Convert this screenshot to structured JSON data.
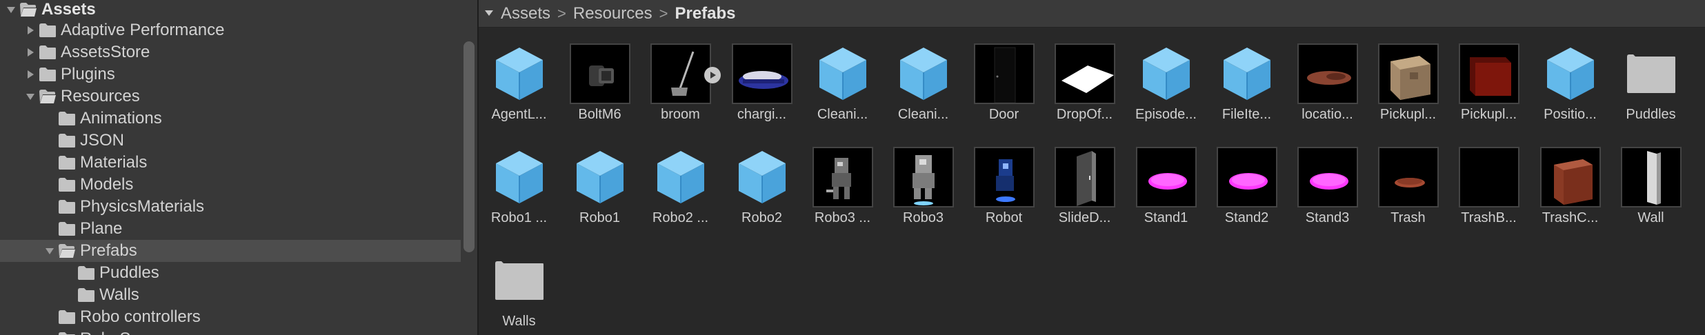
{
  "tree": {
    "items": [
      {
        "label": "Assets",
        "state": "open",
        "bold": true
      },
      {
        "label": "Adaptive Performance",
        "state": "closed"
      },
      {
        "label": "AssetsStore",
        "state": "closed"
      },
      {
        "label": "Plugins",
        "state": "closed"
      },
      {
        "label": "Resources",
        "state": "open"
      },
      {
        "label": "Animations",
        "state": "leaf"
      },
      {
        "label": "JSON",
        "state": "leaf"
      },
      {
        "label": "Materials",
        "state": "leaf"
      },
      {
        "label": "Models",
        "state": "leaf"
      },
      {
        "label": "PhysicsMaterials",
        "state": "leaf"
      },
      {
        "label": "Plane",
        "state": "leaf"
      },
      {
        "label": "Prefabs",
        "state": "open",
        "selected": true
      },
      {
        "label": "Puddles",
        "state": "leaf"
      },
      {
        "label": "Walls",
        "state": "leaf"
      },
      {
        "label": "Robo controllers",
        "state": "leaf"
      },
      {
        "label": "RoboSc",
        "state": "leaf"
      }
    ]
  },
  "breadcrumb": {
    "items": [
      "Assets",
      "Resources",
      "Prefabs"
    ],
    "separator": ">"
  },
  "grid": {
    "items": [
      {
        "label": "AgentL...",
        "thumb": "prefab-cube"
      },
      {
        "label": "BoltM6",
        "thumb": "bolt"
      },
      {
        "label": "broom",
        "thumb": "broom",
        "play": true
      },
      {
        "label": "chargi...",
        "thumb": "charger"
      },
      {
        "label": "Cleani...",
        "thumb": "prefab-cube"
      },
      {
        "label": "Cleani...",
        "thumb": "prefab-cube"
      },
      {
        "label": "Door",
        "thumb": "door"
      },
      {
        "label": "DropOf...",
        "thumb": "plane-white"
      },
      {
        "label": "Episode...",
        "thumb": "prefab-cube"
      },
      {
        "label": "FileIte...",
        "thumb": "prefab-cube"
      },
      {
        "label": "locatio...",
        "thumb": "dish"
      },
      {
        "label": "Pickupl...",
        "thumb": "box-cardboard"
      },
      {
        "label": "Pickupl...",
        "thumb": "box-red"
      },
      {
        "label": "Positio...",
        "thumb": "prefab-cube"
      },
      {
        "label": "Puddles",
        "thumb": "folder"
      },
      {
        "label": "Robo1 ...",
        "thumb": "prefab-cube"
      },
      {
        "label": "Robo1",
        "thumb": "prefab-cube"
      },
      {
        "label": "Robo2 ...",
        "thumb": "prefab-cube"
      },
      {
        "label": "Robo2",
        "thumb": "prefab-cube"
      },
      {
        "label": "Robo3 ...",
        "thumb": "robot-gray"
      },
      {
        "label": "Robo3",
        "thumb": "robot-gray-light"
      },
      {
        "label": "Robot",
        "thumb": "robot-blue"
      },
      {
        "label": "SlideD...",
        "thumb": "slide-door"
      },
      {
        "label": "Stand1",
        "thumb": "stand-magenta"
      },
      {
        "label": "Stand2",
        "thumb": "stand-magenta"
      },
      {
        "label": "Stand3",
        "thumb": "stand-magenta"
      },
      {
        "label": "Trash",
        "thumb": "dish-small"
      },
      {
        "label": "TrashB...",
        "thumb": "empty-dark"
      },
      {
        "label": "TrashC...",
        "thumb": "box-rust"
      },
      {
        "label": "Wall",
        "thumb": "wall"
      },
      {
        "label": "Walls",
        "thumb": "folder"
      }
    ]
  },
  "colors": {
    "panel_bg": "#383838",
    "grid_bg": "#282828",
    "selection": "#4d4d4d",
    "prefab_light": "#8fd3f8",
    "prefab_mid": "#63b9ea",
    "prefab_dark": "#4aa3db",
    "folder": "#c3c3c3",
    "magenta": "#ff39ff"
  }
}
